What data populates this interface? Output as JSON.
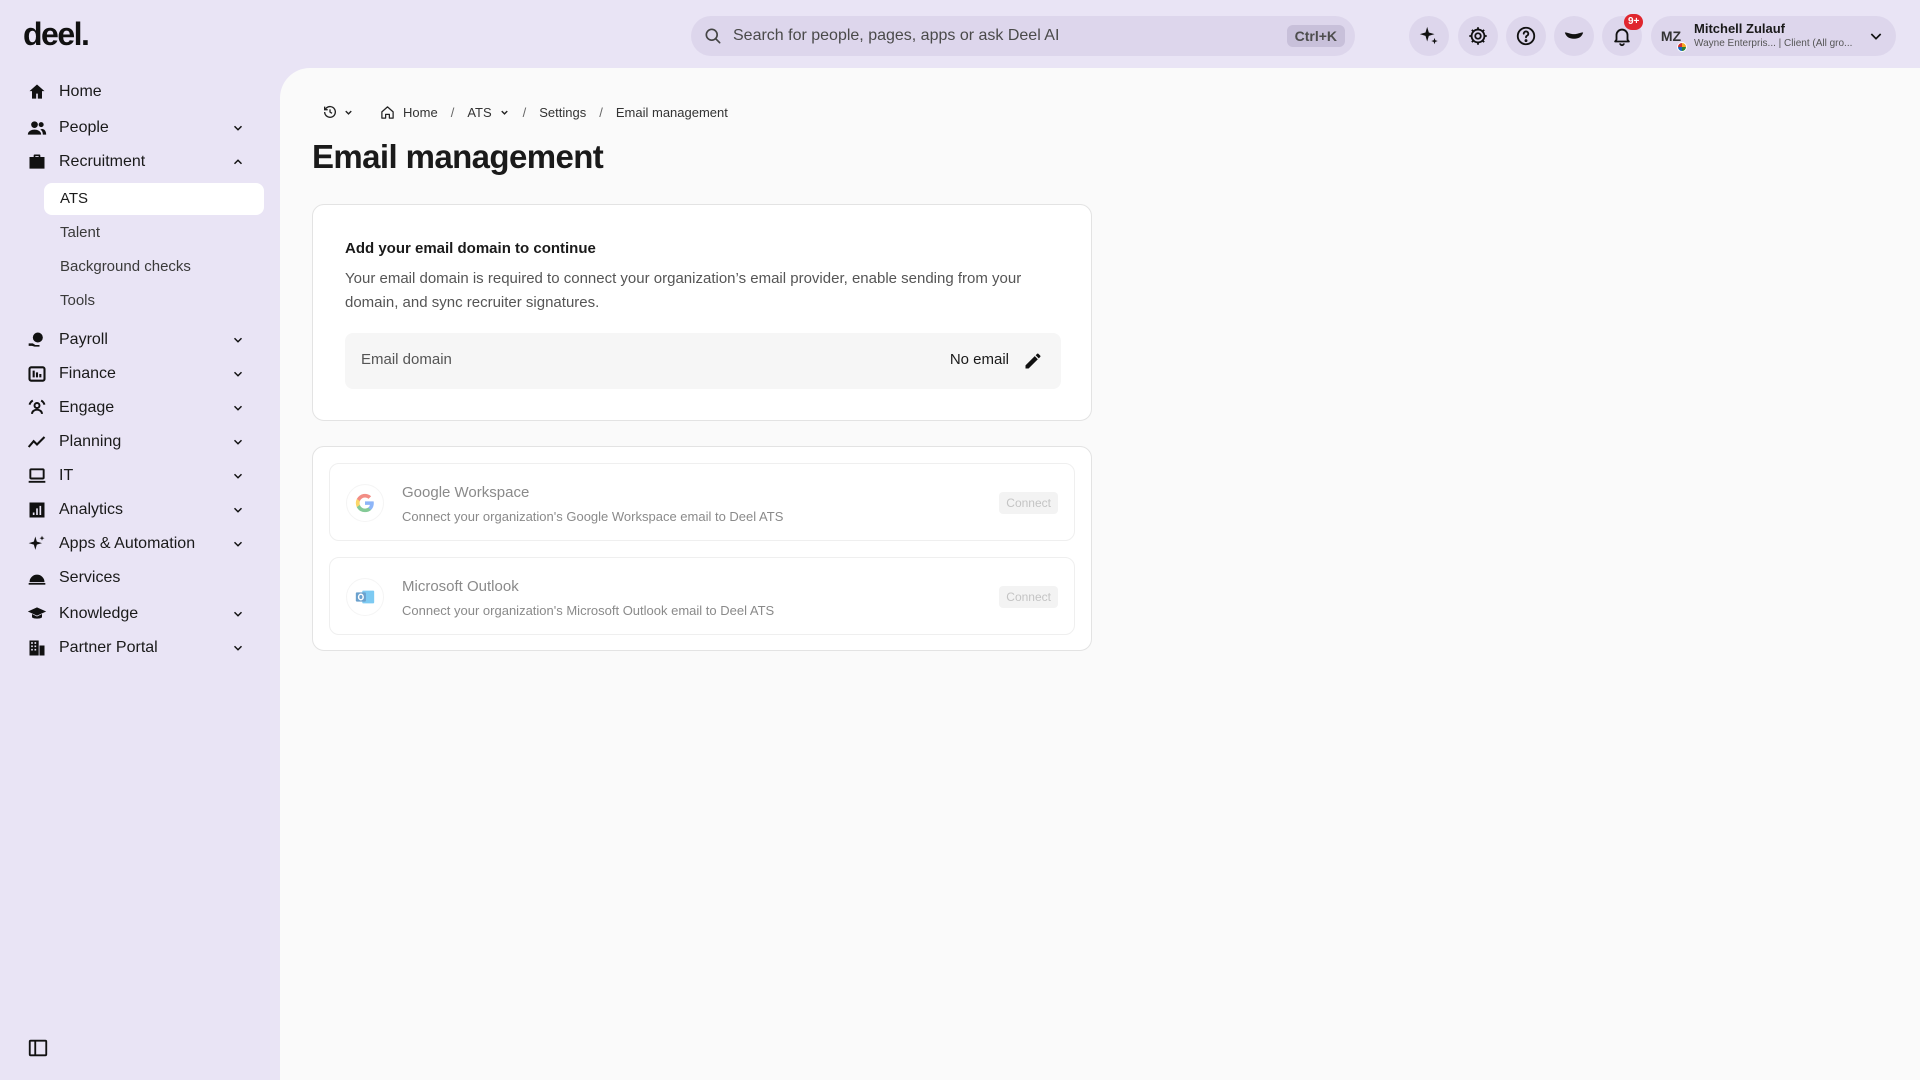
{
  "brand": {
    "logo": "deel."
  },
  "search": {
    "placeholder": "Search for people, pages, apps or ask Deel AI",
    "shortcut": "Ctrl+K"
  },
  "topbar": {
    "notifications_badge": "9+"
  },
  "profile": {
    "initials": "MZ",
    "name": "Mitchell Zulauf",
    "subtitle": "Wayne Enterpris... | Client (All gro..."
  },
  "sidebar": {
    "items": [
      {
        "label": "Home",
        "icon": "home-icon"
      },
      {
        "label": "People",
        "icon": "people-icon"
      },
      {
        "label": "Recruitment",
        "icon": "briefcase-icon"
      },
      {
        "label": "Payroll",
        "icon": "payroll-icon"
      },
      {
        "label": "Finance",
        "icon": "finance-icon"
      },
      {
        "label": "Engage",
        "icon": "engage-icon"
      },
      {
        "label": "Planning",
        "icon": "chart-line-icon"
      },
      {
        "label": "IT",
        "icon": "laptop-icon"
      },
      {
        "label": "Analytics",
        "icon": "analytics-icon"
      },
      {
        "label": "Apps & Automation",
        "icon": "sparkle-icon"
      },
      {
        "label": "Services",
        "icon": "bell-service-icon"
      },
      {
        "label": "Knowledge",
        "icon": "graduation-cap-icon"
      },
      {
        "label": "Partner Portal",
        "icon": "building-icon"
      }
    ],
    "recruitment_sub": [
      "ATS",
      "Talent",
      "Background checks",
      "Tools"
    ]
  },
  "breadcrumb": {
    "home": "Home",
    "ats": "ATS",
    "settings": "Settings",
    "current": "Email management",
    "sep": "/"
  },
  "page": {
    "title": "Email management",
    "domain_card": {
      "title": "Add your email domain to continue",
      "description": "Your email domain is required to connect your organization’s email provider, enable sending from your domain, and sync recruiter signatures.",
      "field_label": "Email domain",
      "field_value": "No email"
    },
    "providers": [
      {
        "name": "Google Workspace",
        "description": "Connect your organization's Google Workspace email to Deel ATS",
        "button": "Connect",
        "icon": "google-icon"
      },
      {
        "name": "Microsoft Outlook",
        "description": "Connect your organization's Microsoft Outlook email to Deel ATS",
        "button": "Connect",
        "icon": "outlook-icon"
      }
    ]
  }
}
